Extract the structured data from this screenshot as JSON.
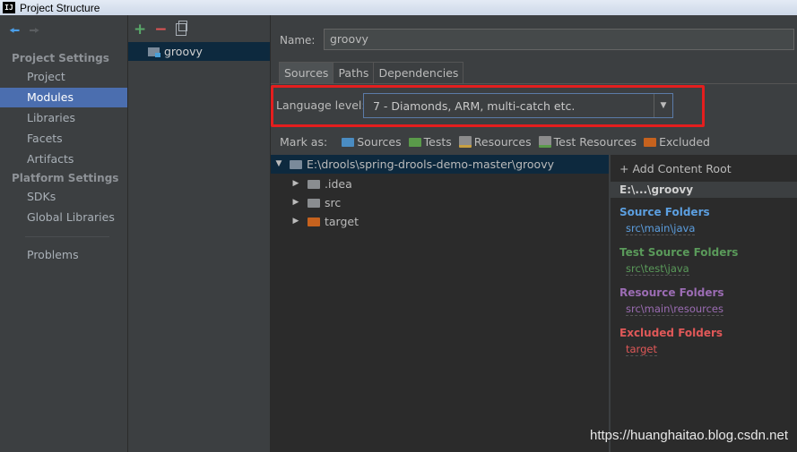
{
  "window": {
    "logo": "IJ",
    "title": "Project Structure"
  },
  "sidebar": {
    "project_settings_header": "Project Settings",
    "project_items": [
      {
        "label": "Project"
      },
      {
        "label": "Modules"
      },
      {
        "label": "Libraries"
      },
      {
        "label": "Facets"
      },
      {
        "label": "Artifacts"
      }
    ],
    "platform_settings_header": "Platform Settings",
    "platform_items": [
      {
        "label": "SDKs"
      },
      {
        "label": "Global Libraries"
      }
    ],
    "problems_label": "Problems"
  },
  "modules": {
    "items": [
      {
        "label": "groovy"
      }
    ]
  },
  "detail": {
    "name_label": "Name:",
    "name_value": "groovy",
    "tabs": [
      {
        "label": "Sources"
      },
      {
        "label": "Paths"
      },
      {
        "label": "Dependencies"
      }
    ],
    "language_level_label": "Language level:",
    "language_level_value": "7 - Diamonds, ARM, multi-catch etc.",
    "mark_as_label": "Mark as:",
    "mark_as_options": [
      {
        "label": "Sources",
        "color": "#4a8cc2"
      },
      {
        "label": "Tests",
        "color": "#5a9a4a"
      },
      {
        "label": "Resources",
        "color": "#8c8c8c"
      },
      {
        "label": "Test Resources",
        "color": "#8c8c8c"
      },
      {
        "label": "Excluded",
        "color": "#c6621e"
      }
    ],
    "tree": [
      {
        "label": "E:\\drools\\spring-drools-demo-master\\groovy"
      },
      {
        "label": ".idea"
      },
      {
        "label": "src"
      },
      {
        "label": "target"
      }
    ]
  },
  "content_roots": {
    "add_label": "+ Add Content Root",
    "root_path": "E:\\...\\groovy",
    "groups": [
      {
        "header": "Source Folders",
        "path": "src\\main\\java",
        "color": "#5c9fe0"
      },
      {
        "header": "Test Source Folders",
        "path": "src\\test\\java",
        "color": "#5a9a5a"
      },
      {
        "header": "Resource Folders",
        "path": "src\\main\\resources",
        "color": "#9b6cb3"
      },
      {
        "header": "Excluded Folders",
        "path": "target",
        "color": "#e05858"
      }
    ]
  },
  "watermark": "https://huanghaitao.blog.csdn.net"
}
